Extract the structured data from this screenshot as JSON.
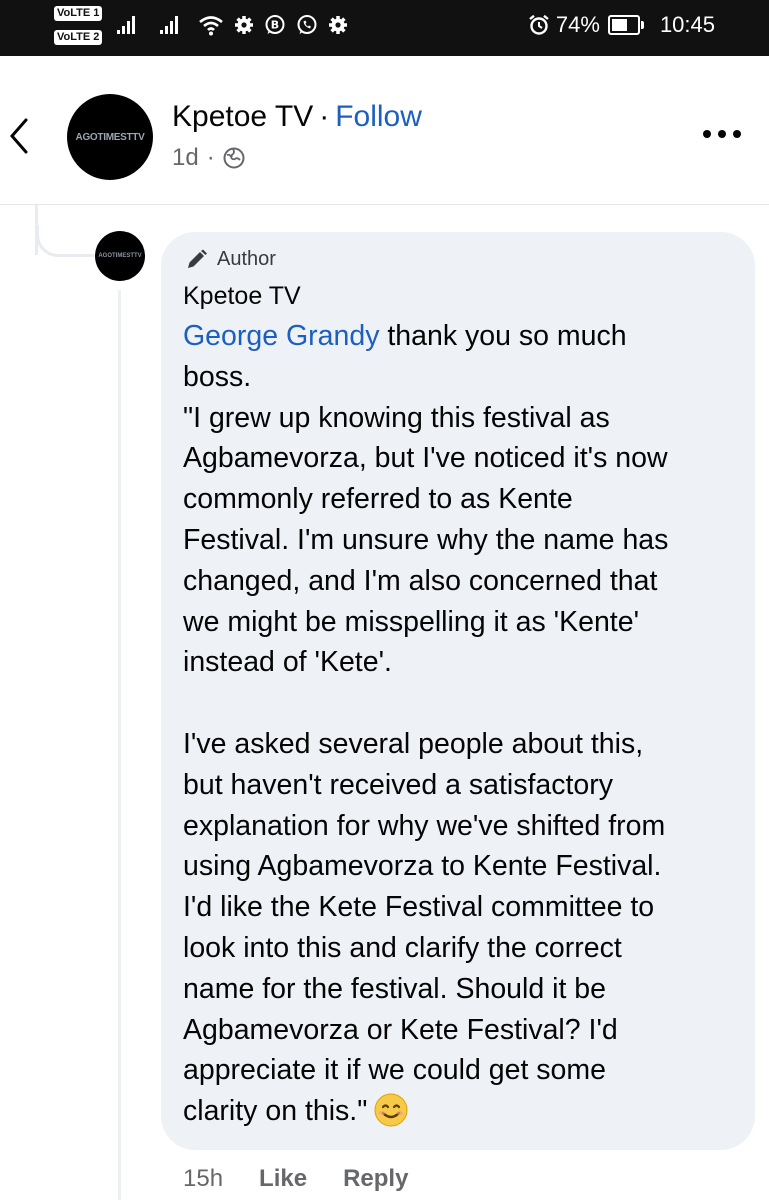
{
  "status_bar": {
    "sim1_label": "VoLTE",
    "sim1_num": "1",
    "sim2_label": "VoLTE",
    "sim2_num": "2",
    "battery_percent": "74%",
    "battery_level": 0.74,
    "time": "10:45",
    "icons": [
      "signal-icon",
      "signal-icon",
      "wifi-icon",
      "settings-icon",
      "whatsapp-business-icon",
      "whatsapp-icon",
      "settings-icon",
      "alarm-icon",
      "battery-icon"
    ]
  },
  "header": {
    "page_name": "Kpetoe TV",
    "separator": "·",
    "follow_label": "Follow",
    "post_age": "1d",
    "meta_separator": "·",
    "avatar_text": "AGOTIMESTTV"
  },
  "comment": {
    "avatar_text": "AGOTIMESTTV",
    "badge": "Author",
    "commenter": "Kpetoe TV",
    "mention": "George Grandy",
    "text_after_mention": " thank you so much\nboss.\n\"I grew up knowing this festival as\nAgbamevorza, but I've noticed it's now\ncommonly referred to as Kente\nFestival. I'm unsure why the name has\nchanged, and I'm also concerned that\nwe might be misspelling it as 'Kente'\ninstead of 'Kete'.\n\nI've asked several people about this,\nbut haven't received a satisfactory\nexplanation for why we've shifted from\nusing Agbamevorza to Kente Festival.\nI'd like the Kete Festival committee to\nlook into this and clarify the correct\nname for the festival. Should it be\nAgbamevorza or Kete Festival? I'd\nappreciate it if we could get some\nclarity on this.\"",
    "time": "15h",
    "like_label": "Like",
    "reply_label": "Reply"
  }
}
